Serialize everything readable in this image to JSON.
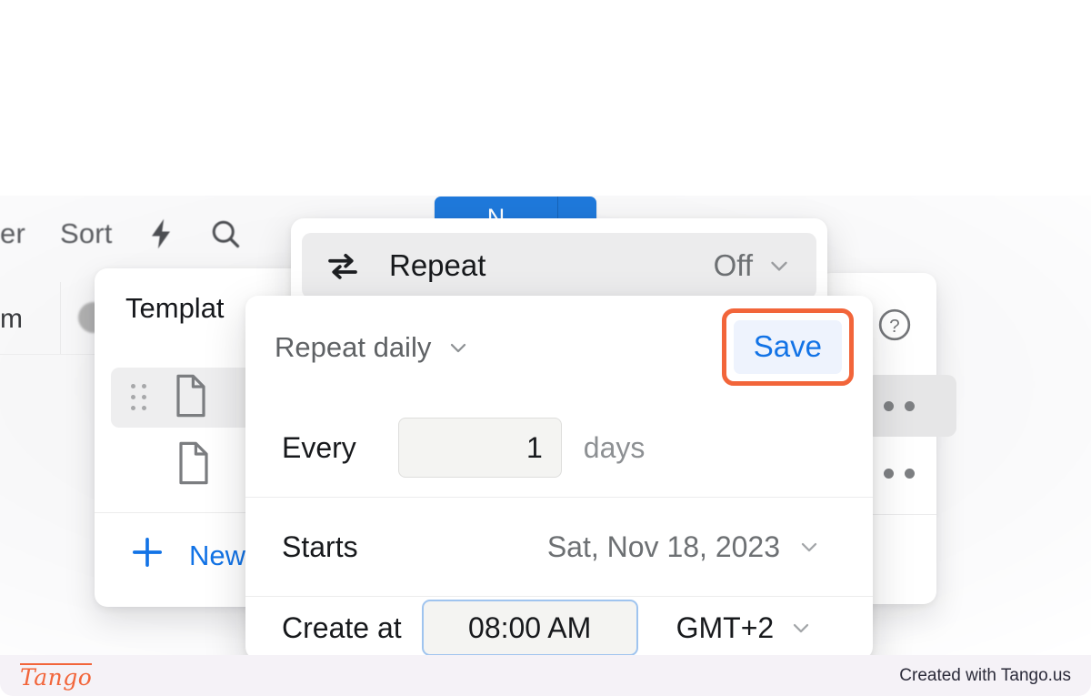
{
  "app": {
    "background_toolbar": {
      "filter_label": "er",
      "sort_label": "Sort",
      "lightning_icon": "lightning-bolt-icon",
      "search_icon": "search-icon"
    },
    "background_grid": {
      "cell_text": "m"
    },
    "primary_button": {
      "label": "N",
      "color": "#1f79db"
    }
  },
  "templates_card": {
    "title": "Templat",
    "rows": [
      {
        "drag_handle": "drag-handle-icon",
        "file_icon": "document-icon"
      },
      {
        "file_icon": "document-icon"
      }
    ],
    "new_button": {
      "icon": "plus-icon",
      "label": "New",
      "color": "#1273e6"
    }
  },
  "right_card": {
    "help_icon": "question-mark-circle-icon",
    "menu_rows": [
      "more-options-icon",
      "more-options-icon"
    ]
  },
  "repeat_popover": {
    "icon": "repeat-loop-icon",
    "label": "Repeat",
    "value": "Off",
    "chevron": "chevron-down-icon"
  },
  "settings_popover": {
    "frequency": {
      "label": "Repeat daily",
      "chevron": "chevron-down-icon"
    },
    "save_button": {
      "label": "Save",
      "text_color": "#1273e6",
      "background": "#eef3fd",
      "highlight_color": "#f2653a"
    },
    "rows": {
      "every": {
        "label": "Every",
        "value": "1",
        "unit": "days"
      },
      "starts": {
        "label": "Starts",
        "value": "Sat, Nov 18, 2023",
        "chevron": "chevron-down-icon"
      },
      "create_at": {
        "label": "Create at",
        "time": "08:00 AM",
        "timezone": "GMT+2",
        "chevron": "chevron-down-icon"
      }
    }
  },
  "footer": {
    "logo": "Tango",
    "note": "Created with Tango.us"
  }
}
